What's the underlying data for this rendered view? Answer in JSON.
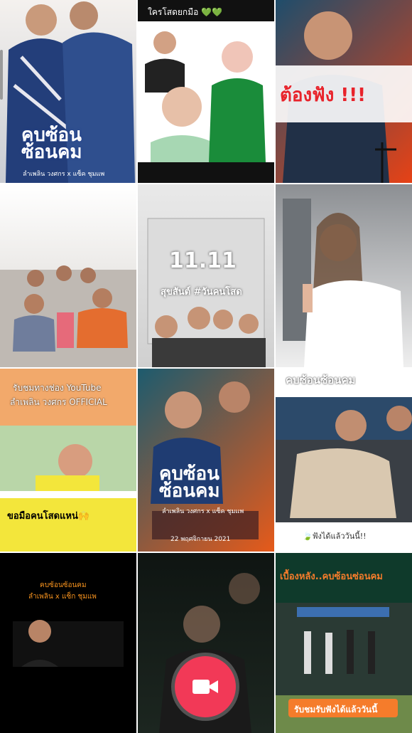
{
  "videos": [
    {
      "title": "คบซ้อน ซ้อนคม",
      "credit": "ลำเพลิน วงศกร x แซ็ค ชุมแพ",
      "color_top": "#f4f1ee",
      "color_bottom": "#c9ccd3",
      "accent": "#1f3c8c"
    },
    {
      "banner": "ใครโสดยกมือ 💚💚",
      "color_top": "#ffffff",
      "color_bottom": "#eaeaea",
      "accent": "#111111"
    },
    {
      "headline": "ต้องฟัง !!!",
      "color_top": "#1f4d6b",
      "color_bottom": "#e64216",
      "accent": "#e8232b"
    },
    {
      "color_top": "#ffffff",
      "color_bottom": "#d6d2cd",
      "accent": "#e46d2f"
    },
    {
      "date": "11.11",
      "caption": "สุขสันต์ #วันคนโสด",
      "color_top": "#e9e9e9",
      "color_bottom": "#d0d0d0",
      "accent": "#2a2a2a"
    },
    {
      "color_top": "#8c8f93",
      "color_bottom": "#efefef",
      "accent": "#ffffff"
    },
    {
      "line1": "รับชมทางช่อง YouTube",
      "line2": "ลำเพลิน วงศกร OFFICIAL",
      "bottom": "ขอมือคนโสดแหน่🙌",
      "color_top": "#f2a96b",
      "color_bottom": "#f3e63b",
      "accent": "#000000"
    },
    {
      "title": "คบซ้อน ซ้อนคม",
      "credit": "ลำเพลิน วงศกร x แซ็ค ชุมแพ",
      "date": "22 พฤศจิกายน 2021",
      "color_top": "#1d5b6e",
      "color_bottom": "#e65a1a",
      "accent": "#ffffff"
    },
    {
      "top": "คบซ้อนซ้อนคม",
      "bottom": "🍃ฟังได้แล้ววันนี้!!",
      "color_top": "#3a3f45",
      "color_bottom": "#6a6a60",
      "accent": "#ffffff"
    },
    {
      "line1": "คบซ้อนซ้อนคม",
      "line2": "ลำเพลิน x แซ็ก ชุมแพ",
      "color_top": "#000000",
      "color_bottom": "#0a0a0a",
      "accent": "#f7931e"
    },
    {
      "color_top": "#0f1512",
      "color_bottom": "#1c2620",
      "accent": "#f23957"
    },
    {
      "top": "เบื้องหลัง..คบซ้อนซ่อนคม",
      "bottom": "รับชมรับฟังได้แล้ววันนี้",
      "color_top": "#0f3a2b",
      "color_bottom": "#6e8a4a",
      "accent": "#f57c2b"
    }
  ],
  "record_button": {
    "icon": "video-camera-icon",
    "color": "#f23957"
  }
}
